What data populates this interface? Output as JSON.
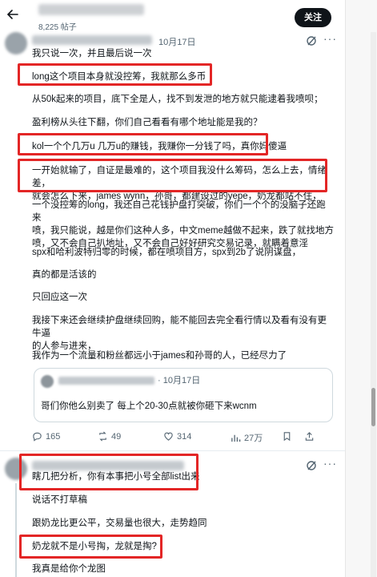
{
  "header": {
    "post_count": "8,225 帖子",
    "follow_label": "关注"
  },
  "icons": {
    "back": "arrow-left-icon",
    "grok": "grok-icon",
    "more": "more-icon"
  },
  "colors": {
    "highlight": "#e32626",
    "follow_bg": "#0f1419",
    "muted": "#536471"
  },
  "tweet1": {
    "date": "10月17日",
    "paragraphs": [
      "我只说一次，并且最后说一次",
      "long这个项目本身就没控筹，我就那么多币",
      "从50k起来的项目，底下全是人，找不到发泄的地方就只能逮着我喷呗；",
      "盈利榜从头往下翻，你们自己看看有哪个地址能是我的？",
      "kol一个个几万u 几万u的赚钱，我赚你一分钱了吗，真你妈傻逼",
      "一开始就输了，自证是最难的，这个项目我没什么筹码，怎么上去，情绪差，\n就会怎么下来，james wynn，孙哥，都建设过的yepe，奶龙都站不住，",
      "一个没控筹的long，我还自己花钱护盘打突破，你们一个个的没脑子还跑来\n喷，我只能说，越是你们这种人多，中文meme越做不起来，跌了就找地方\n喷，又不会自己扒地址，又不会自己好好研究交易记录，就瞒着意淫",
      "spx和哈利波特归零的时候，都在喷项目方，spx到2b了说阴谋盘，",
      "真的都是活该的",
      "只回应这一次",
      "我接下来还会继续护盘继续回购，能不能回去完全看行情以及看有没有更牛逼\n的人参与进来，",
      "我作为一个流量和粉丝都远小于james和孙哥的人，已经尽力了"
    ],
    "quote": {
      "date": "· 10月17日",
      "text": "哥们你他么别卖了 每上个20-30点就被你砸下来wcnm"
    },
    "actions": {
      "replies": "165",
      "reposts": "49",
      "likes": "314",
      "views": "27万"
    }
  },
  "tweet2": {
    "paragraphs": [
      "瞎几把分析，你有本事把小号全部list出来",
      "说话不打草稿",
      "跟奶龙比更公平，交易量也很大，走势趋同",
      "奶龙就不是小号掏，龙就是掏?",
      "我真是给你个龙图"
    ]
  }
}
